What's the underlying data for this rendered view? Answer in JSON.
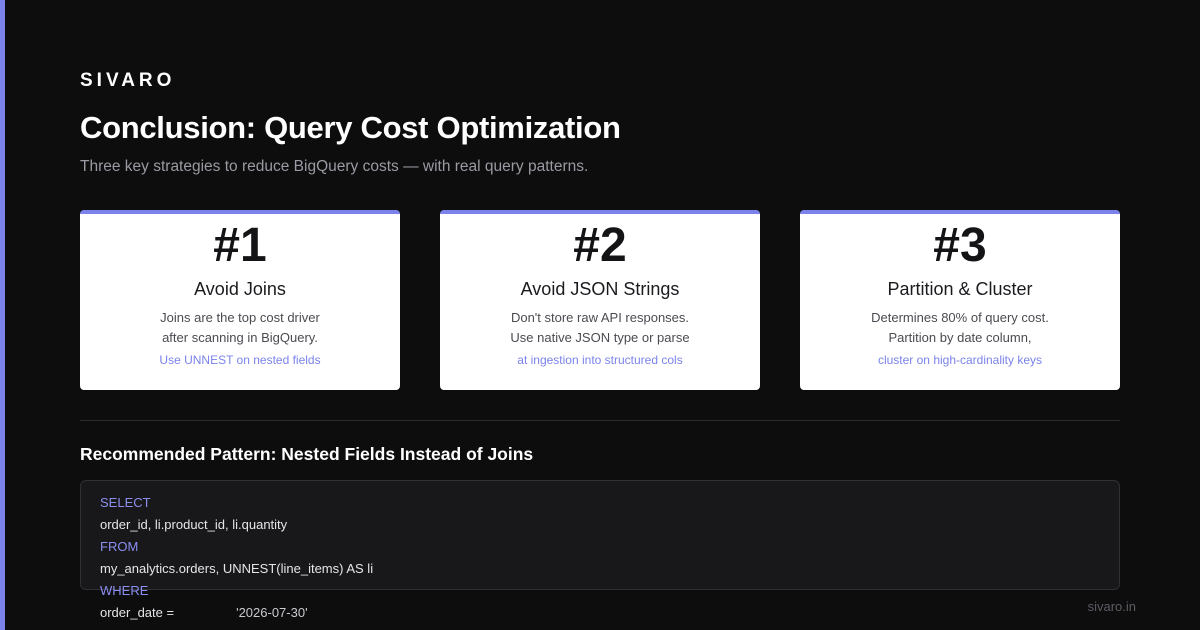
{
  "brand": "SIVARO",
  "title": "Conclusion: Query Cost Optimization",
  "subtitle": "Three key strategies to reduce BigQuery costs — with real query patterns.",
  "accent_color": "#7b83eb",
  "cards": [
    {
      "number": "#1",
      "title": "Avoid Joins",
      "line1": "Joins are the top cost driver",
      "line2": "after scanning in BigQuery.",
      "hint": "Use UNNEST on nested fields"
    },
    {
      "number": "#2",
      "title": "Avoid JSON Strings",
      "line1": "Don't store raw API responses.",
      "line2": "Use native JSON type or parse",
      "hint": "at ingestion into structured cols"
    },
    {
      "number": "#3",
      "title": "Partition & Cluster",
      "line1": "Determines 80% of query cost.",
      "line2": "Partition by date column,",
      "hint": "cluster on high-cardinality keys"
    }
  ],
  "section_title": "Recommended Pattern: Nested Fields Instead of Joins",
  "code": {
    "kw_select": "SELECT",
    "select_cols": "order_id, li.product_id, li.quantity",
    "kw_from": "FROM",
    "from_expr": "my_analytics.orders, UNNEST(line_items) AS li",
    "kw_where": "WHERE",
    "where_lhs": "order_date =",
    "where_val": "'2026-07-30'"
  },
  "footer": "sivaro.in"
}
